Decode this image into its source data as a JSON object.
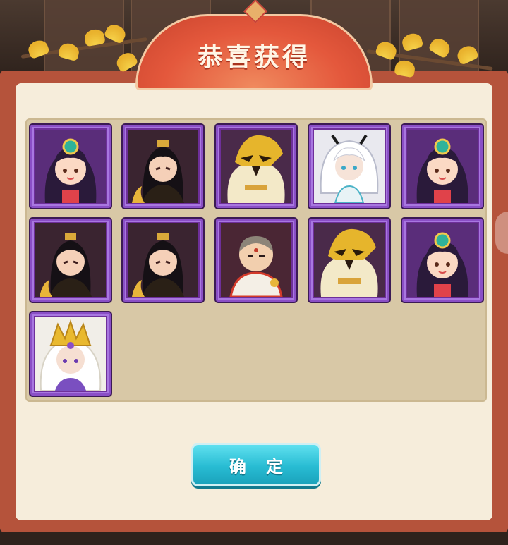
{
  "dialog": {
    "title": "恭喜获得",
    "confirm_label": "确 定"
  },
  "rewards": [
    {
      "hero": "dancer",
      "rarity": "epic"
    },
    {
      "hero": "emperor",
      "rarity": "epic"
    },
    {
      "hero": "golden-mask",
      "rarity": "epic"
    },
    {
      "hero": "white-hair",
      "rarity": "epic"
    },
    {
      "hero": "dancer",
      "rarity": "epic"
    },
    {
      "hero": "emperor",
      "rarity": "epic"
    },
    {
      "hero": "emperor",
      "rarity": "epic"
    },
    {
      "hero": "monk",
      "rarity": "epic"
    },
    {
      "hero": "golden-mask",
      "rarity": "epic"
    },
    {
      "hero": "dancer",
      "rarity": "epic"
    },
    {
      "hero": "golden-crown",
      "rarity": "epic"
    }
  ],
  "colors": {
    "epic_frame": "#8a4fc6",
    "banner": "#e4583c",
    "button": "#28bcd3",
    "panel": "#f6ecd9"
  }
}
